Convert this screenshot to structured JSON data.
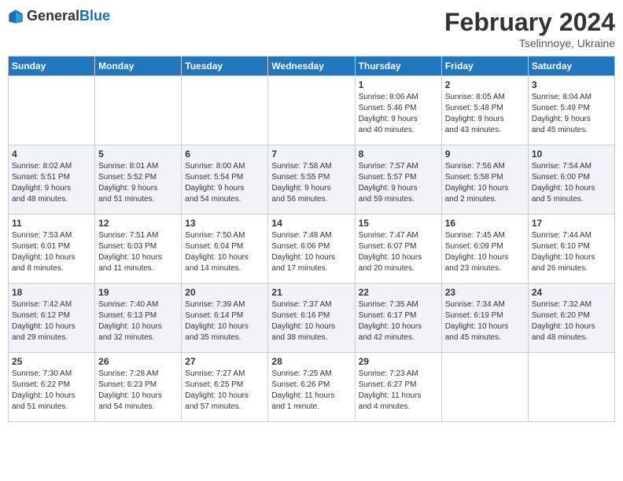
{
  "logo": {
    "general": "General",
    "blue": "Blue"
  },
  "title": "February 2024",
  "subtitle": "Tselinnoye, Ukraine",
  "days_of_week": [
    "Sunday",
    "Monday",
    "Tuesday",
    "Wednesday",
    "Thursday",
    "Friday",
    "Saturday"
  ],
  "weeks": [
    [
      {
        "day": "",
        "info": ""
      },
      {
        "day": "",
        "info": ""
      },
      {
        "day": "",
        "info": ""
      },
      {
        "day": "",
        "info": ""
      },
      {
        "day": "1",
        "info": "Sunrise: 8:06 AM\nSunset: 5:46 PM\nDaylight: 9 hours\nand 40 minutes."
      },
      {
        "day": "2",
        "info": "Sunrise: 8:05 AM\nSunset: 5:48 PM\nDaylight: 9 hours\nand 43 minutes."
      },
      {
        "day": "3",
        "info": "Sunrise: 8:04 AM\nSunset: 5:49 PM\nDaylight: 9 hours\nand 45 minutes."
      }
    ],
    [
      {
        "day": "4",
        "info": "Sunrise: 8:02 AM\nSunset: 5:51 PM\nDaylight: 9 hours\nand 48 minutes."
      },
      {
        "day": "5",
        "info": "Sunrise: 8:01 AM\nSunset: 5:52 PM\nDaylight: 9 hours\nand 51 minutes."
      },
      {
        "day": "6",
        "info": "Sunrise: 8:00 AM\nSunset: 5:54 PM\nDaylight: 9 hours\nand 54 minutes."
      },
      {
        "day": "7",
        "info": "Sunrise: 7:58 AM\nSunset: 5:55 PM\nDaylight: 9 hours\nand 56 minutes."
      },
      {
        "day": "8",
        "info": "Sunrise: 7:57 AM\nSunset: 5:57 PM\nDaylight: 9 hours\nand 59 minutes."
      },
      {
        "day": "9",
        "info": "Sunrise: 7:56 AM\nSunset: 5:58 PM\nDaylight: 10 hours\nand 2 minutes."
      },
      {
        "day": "10",
        "info": "Sunrise: 7:54 AM\nSunset: 6:00 PM\nDaylight: 10 hours\nand 5 minutes."
      }
    ],
    [
      {
        "day": "11",
        "info": "Sunrise: 7:53 AM\nSunset: 6:01 PM\nDaylight: 10 hours\nand 8 minutes."
      },
      {
        "day": "12",
        "info": "Sunrise: 7:51 AM\nSunset: 6:03 PM\nDaylight: 10 hours\nand 11 minutes."
      },
      {
        "day": "13",
        "info": "Sunrise: 7:50 AM\nSunset: 6:04 PM\nDaylight: 10 hours\nand 14 minutes."
      },
      {
        "day": "14",
        "info": "Sunrise: 7:48 AM\nSunset: 6:06 PM\nDaylight: 10 hours\nand 17 minutes."
      },
      {
        "day": "15",
        "info": "Sunrise: 7:47 AM\nSunset: 6:07 PM\nDaylight: 10 hours\nand 20 minutes."
      },
      {
        "day": "16",
        "info": "Sunrise: 7:45 AM\nSunset: 6:09 PM\nDaylight: 10 hours\nand 23 minutes."
      },
      {
        "day": "17",
        "info": "Sunrise: 7:44 AM\nSunset: 6:10 PM\nDaylight: 10 hours\nand 26 minutes."
      }
    ],
    [
      {
        "day": "18",
        "info": "Sunrise: 7:42 AM\nSunset: 6:12 PM\nDaylight: 10 hours\nand 29 minutes."
      },
      {
        "day": "19",
        "info": "Sunrise: 7:40 AM\nSunset: 6:13 PM\nDaylight: 10 hours\nand 32 minutes."
      },
      {
        "day": "20",
        "info": "Sunrise: 7:39 AM\nSunset: 6:14 PM\nDaylight: 10 hours\nand 35 minutes."
      },
      {
        "day": "21",
        "info": "Sunrise: 7:37 AM\nSunset: 6:16 PM\nDaylight: 10 hours\nand 38 minutes."
      },
      {
        "day": "22",
        "info": "Sunrise: 7:35 AM\nSunset: 6:17 PM\nDaylight: 10 hours\nand 42 minutes."
      },
      {
        "day": "23",
        "info": "Sunrise: 7:34 AM\nSunset: 6:19 PM\nDaylight: 10 hours\nand 45 minutes."
      },
      {
        "day": "24",
        "info": "Sunrise: 7:32 AM\nSunset: 6:20 PM\nDaylight: 10 hours\nand 48 minutes."
      }
    ],
    [
      {
        "day": "25",
        "info": "Sunrise: 7:30 AM\nSunset: 6:22 PM\nDaylight: 10 hours\nand 51 minutes."
      },
      {
        "day": "26",
        "info": "Sunrise: 7:28 AM\nSunset: 6:23 PM\nDaylight: 10 hours\nand 54 minutes."
      },
      {
        "day": "27",
        "info": "Sunrise: 7:27 AM\nSunset: 6:25 PM\nDaylight: 10 hours\nand 57 minutes."
      },
      {
        "day": "28",
        "info": "Sunrise: 7:25 AM\nSunset: 6:26 PM\nDaylight: 11 hours\nand 1 minute."
      },
      {
        "day": "29",
        "info": "Sunrise: 7:23 AM\nSunset: 6:27 PM\nDaylight: 11 hours\nand 4 minutes."
      },
      {
        "day": "",
        "info": ""
      },
      {
        "day": "",
        "info": ""
      }
    ]
  ]
}
